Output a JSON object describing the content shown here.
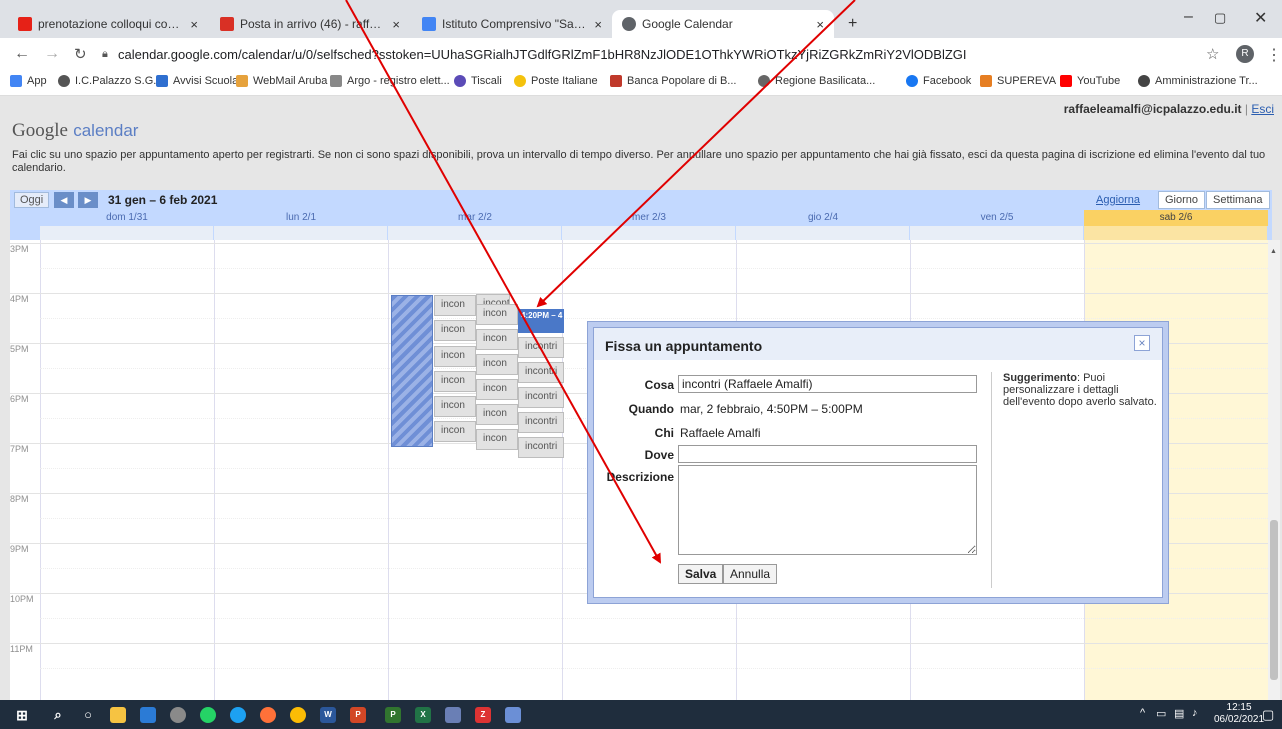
{
  "browser": {
    "tabs": [
      {
        "label": "prenotazione colloqui con calend",
        "favicon_color": "#e62117",
        "active": false
      },
      {
        "label": "Posta in arrivo (46) - raffaeleamal",
        "favicon_color": "#d93025",
        "active": false
      },
      {
        "label": "Istituto Comprensivo \"San Giova",
        "favicon_color": "#4285f4",
        "active": false
      },
      {
        "label": "Google Calendar",
        "favicon_color": "#5f6368",
        "active": true
      }
    ],
    "new_tab": "+",
    "url": "calendar.google.com/calendar/u/0/selfsched?sstoken=UUhaSGRialhJTGdlfGRlZmF1bHR8NzJlODE1OThkYWRiOTkzYjRiZGRkZmRiY2VlODBlZGI",
    "profile_initial": "R",
    "bookmarks": [
      {
        "label": "App",
        "color": "#4285f4"
      },
      {
        "label": "I.C.Palazzo S.G.",
        "color": "#555555"
      },
      {
        "label": "Avvisi Scuola",
        "color": "#2f6fd0"
      },
      {
        "label": "WebMail Aruba",
        "color": "#e6a23c"
      },
      {
        "label": "Argo - registro elett...",
        "color": "#888888"
      },
      {
        "label": "Tiscali",
        "color": "#5b4bb7"
      },
      {
        "label": "Poste Italiane",
        "color": "#f4c20d"
      },
      {
        "label": "Banca Popolare di B...",
        "color": "#c0392b"
      },
      {
        "label": "Regione Basilicata...",
        "color": "#666666"
      },
      {
        "label": "Facebook",
        "color": "#1877f2"
      },
      {
        "label": "SUPEREVA",
        "color": "#e67e22"
      },
      {
        "label": "YouTube",
        "color": "#ff0000"
      },
      {
        "label": "Amministrazione Tr...",
        "color": "#444444"
      }
    ]
  },
  "page": {
    "user_email": "raffaeleamalfi@icpalazzo.edu.it",
    "separator": " | ",
    "exit_link": "Esci",
    "logo_google": "Google",
    "logo_calendar": "calendar",
    "info_text": "Fai clic su uno spazio per appuntamento aperto per registrarti. Se non ci sono spazi disponibili, prova un intervallo di tempo diverso. Per annullare uno spazio per appuntamento che hai già fissato, esci da questa pagina di iscrizione ed elimina l'evento dal tuo calendario."
  },
  "toolbar": {
    "today_label": "Oggi",
    "prev_icon": "◀",
    "next_icon": "▶",
    "date_range": "31 gen – 6 feb 2021",
    "refresh_label": "Aggiorna",
    "day_view_label": "Giorno",
    "week_view_label": "Settimana"
  },
  "calendar": {
    "days": [
      "dom 1/31",
      "lun 2/1",
      "mar 2/2",
      "mer 2/3",
      "gio 2/4",
      "ven 2/5",
      "sab 2/6"
    ],
    "today_index": 6,
    "hours": [
      "3PM",
      "4PM",
      "5PM",
      "6PM",
      "7PM",
      "8PM",
      "9PM",
      "10PM",
      "11PM"
    ],
    "slots_col1": [
      "incon",
      "incon",
      "incon",
      "incon",
      "incon",
      "incon"
    ],
    "slots_col2": [
      "incontri",
      "incon",
      "incon",
      "incon",
      "incon",
      "incon",
      "incon"
    ],
    "slots_col3": [
      "incontri",
      "incontri",
      "incontri",
      "incontri",
      "incontri"
    ],
    "selected_slot_label": "4:20PM – 4"
  },
  "dialog": {
    "title": "Fissa un appuntamento",
    "close_icon": "×",
    "what_label": "Cosa",
    "what_value": "incontri (Raffaele Amalfi)",
    "when_label": "Quando",
    "when_value": "mar, 2 febbraio, 4:50PM – 5:00PM",
    "who_label": "Chi",
    "who_value": "Raffaele Amalfi",
    "where_label": "Dove",
    "where_value": "",
    "description_label": "Descrizione",
    "save_label": "Salva",
    "cancel_label": "Annulla",
    "tip_title": "Suggerimento",
    "tip_text": ": Puoi personalizzare i dettagli dell'evento dopo averlo salvato."
  },
  "taskbar": {
    "apps": [
      {
        "name": "file-explorer",
        "color": "#f6c342",
        "label": ""
      },
      {
        "name": "app-2",
        "color": "#2b7bd6",
        "label": ""
      },
      {
        "name": "app-3",
        "color": "#8a8a8a",
        "label": ""
      },
      {
        "name": "whatsapp",
        "color": "#25d366",
        "label": ""
      },
      {
        "name": "edge",
        "color": "#1da1f2",
        "label": ""
      },
      {
        "name": "firefox",
        "color": "#ff7139",
        "label": ""
      },
      {
        "name": "chrome",
        "color": "#fbbc05",
        "label": ""
      },
      {
        "name": "word",
        "color": "#2b579a",
        "label": "W"
      },
      {
        "name": "powerpoint",
        "color": "#d24726",
        "label": "P"
      },
      {
        "name": "project",
        "color": "#31752f",
        "label": "P"
      },
      {
        "name": "excel",
        "color": "#217346",
        "label": "X"
      },
      {
        "name": "app-12",
        "color": "#6a7fb5",
        "label": ""
      },
      {
        "name": "app-13",
        "color": "#d33",
        "label": "Z"
      },
      {
        "name": "app-14",
        "color": "#6b8fd6",
        "label": ""
      }
    ],
    "time": "12:15",
    "date": "06/02/2021"
  },
  "colors": {
    "accent_blue": "#c3d9ff",
    "today_yellow": "#fad163",
    "arrow_red": "#e00000"
  }
}
